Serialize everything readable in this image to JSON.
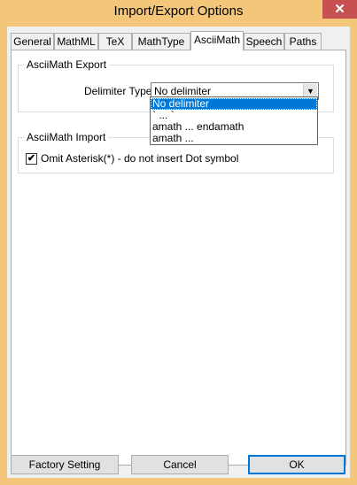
{
  "window": {
    "title": "Import/Export Options",
    "close_glyph": "✕"
  },
  "tabs": [
    {
      "label": "General"
    },
    {
      "label": "MathML"
    },
    {
      "label": "TeX"
    },
    {
      "label": "MathType"
    },
    {
      "label": "AsciiMath",
      "active": true
    },
    {
      "label": "Speech"
    },
    {
      "label": "Paths"
    }
  ],
  "export_group": {
    "title": "AsciiMath Export",
    "delimiter_label": "Delimiter Type:",
    "delimiter_value": "No delimiter",
    "arrow_glyph": "▼",
    "options": [
      "No delimiter",
      "` ... `",
      "amath ... endamath",
      "amath ..."
    ],
    "selected_index": 0
  },
  "import_group": {
    "title": "AsciiMath Import",
    "omit_asterisk_label": "Omit Asterisk(*) - do not insert Dot symbol",
    "omit_asterisk_checked": true,
    "check_glyph": "✔"
  },
  "buttons": {
    "factory": "Factory Setting",
    "cancel": "Cancel",
    "ok": "OK"
  }
}
